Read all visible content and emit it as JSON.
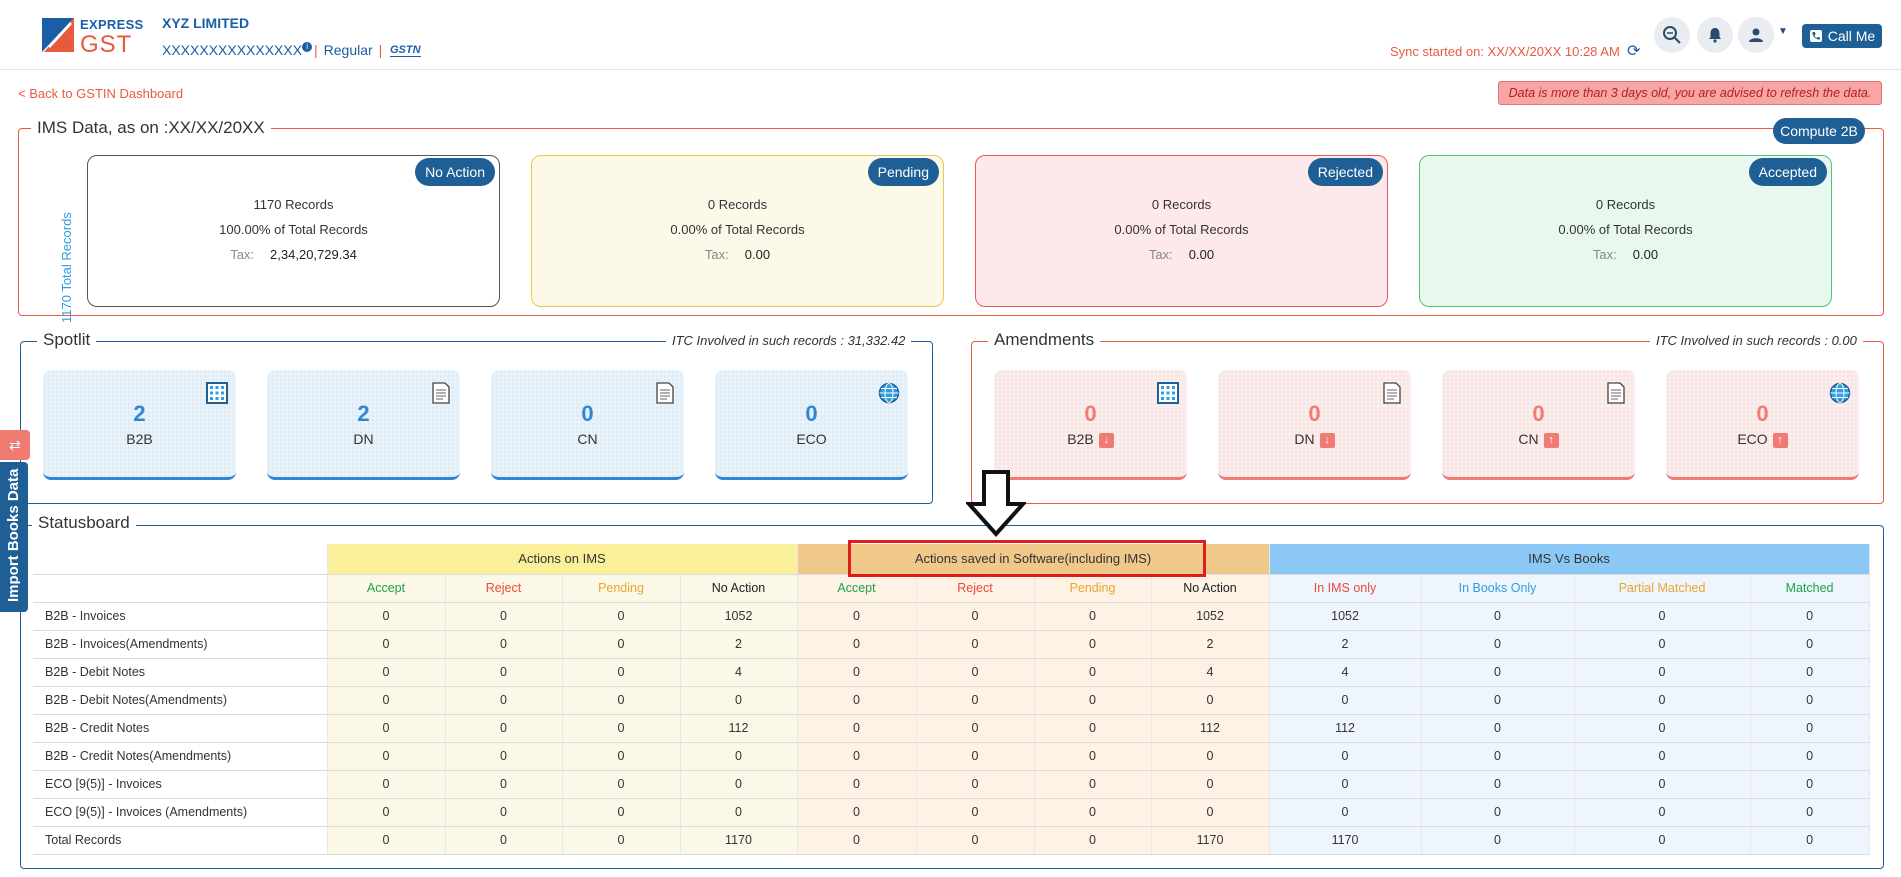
{
  "header": {
    "logo_top": "EXPRESS",
    "logo_bottom": "GST",
    "company": "XYZ LIMITED",
    "gstin": "XXXXXXXXXXXXXXX",
    "reg_type": "Regular",
    "gsn_icon_text": "GSTN",
    "sync_text": "Sync started on: XX/XX/20XX 10:28 AM",
    "call_label": "Call Me"
  },
  "back_link": "< Back to GSTIN Dashboard",
  "stale_alert": "Data is more than 3 days old, you are advised to refresh the data.",
  "ims": {
    "legend": "IMS Data, as on :XX/XX/20XX",
    "compute_label": "Compute 2B",
    "total_label": "1170 Total Records",
    "tax_key": "Tax:",
    "cards": [
      {
        "badge": "No Action",
        "records": "1170 Records",
        "percent": "100.00% of Total Records",
        "tax": "2,34,20,729.34"
      },
      {
        "badge": "Pending",
        "records": "0 Records",
        "percent": "0.00% of Total Records",
        "tax": "0.00"
      },
      {
        "badge": "Rejected",
        "records": "0 Records",
        "percent": "0.00% of Total Records",
        "tax": "0.00"
      },
      {
        "badge": "Accepted",
        "records": "0 Records",
        "percent": "0.00% of Total Records",
        "tax": "0.00"
      }
    ]
  },
  "spotlit": {
    "legend": "Spotlit",
    "note": "ITC Involved in such records : 31,332.42",
    "cards": [
      {
        "value": "2",
        "label": "B2B",
        "icon": "grid-icon"
      },
      {
        "value": "2",
        "label": "DN",
        "icon": "document-icon"
      },
      {
        "value": "0",
        "label": "CN",
        "icon": "document-icon"
      },
      {
        "value": "0",
        "label": "ECO",
        "icon": "globe-icon"
      }
    ]
  },
  "amendments": {
    "legend": "Amendments",
    "note": "ITC Involved in such records : 0.00",
    "cards": [
      {
        "value": "0",
        "label": "B2B",
        "icon": "grid-icon",
        "arrow": "down"
      },
      {
        "value": "0",
        "label": "DN",
        "icon": "document-icon",
        "arrow": "down"
      },
      {
        "value": "0",
        "label": "CN",
        "icon": "document-icon",
        "arrow": "up"
      },
      {
        "value": "0",
        "label": "ECO",
        "icon": "globe-icon",
        "arrow": "up"
      }
    ]
  },
  "import_tab": "Import Books Data",
  "statusboard": {
    "legend": "Statusboard",
    "groups": [
      "Actions on IMS",
      "Actions saved in Software(including IMS)",
      "IMS Vs Books"
    ],
    "columns": [
      "Accept",
      "Reject",
      "Pending",
      "No Action",
      "Accept",
      "Reject",
      "Pending",
      "No Action",
      "In IMS only",
      "In Books Only",
      "Partial Matched",
      "Matched"
    ],
    "rows": [
      {
        "label": "B2B - Invoices",
        "values": [
          "0",
          "0",
          "0",
          "1052",
          "0",
          "0",
          "0",
          "1052",
          "1052",
          "0",
          "0",
          "0"
        ]
      },
      {
        "label": "B2B - Invoices(Amendments)",
        "values": [
          "0",
          "0",
          "0",
          "2",
          "0",
          "0",
          "0",
          "2",
          "2",
          "0",
          "0",
          "0"
        ]
      },
      {
        "label": "B2B - Debit Notes",
        "values": [
          "0",
          "0",
          "0",
          "4",
          "0",
          "0",
          "0",
          "4",
          "4",
          "0",
          "0",
          "0"
        ]
      },
      {
        "label": "B2B - Debit Notes(Amendments)",
        "values": [
          "0",
          "0",
          "0",
          "0",
          "0",
          "0",
          "0",
          "0",
          "0",
          "0",
          "0",
          "0"
        ]
      },
      {
        "label": "B2B - Credit Notes",
        "values": [
          "0",
          "0",
          "0",
          "112",
          "0",
          "0",
          "0",
          "112",
          "112",
          "0",
          "0",
          "0"
        ]
      },
      {
        "label": "B2B - Credit Notes(Amendments)",
        "values": [
          "0",
          "0",
          "0",
          "0",
          "0",
          "0",
          "0",
          "0",
          "0",
          "0",
          "0",
          "0"
        ]
      },
      {
        "label": "ECO [9(5)] - Invoices",
        "values": [
          "0",
          "0",
          "0",
          "0",
          "0",
          "0",
          "0",
          "0",
          "0",
          "0",
          "0",
          "0"
        ]
      },
      {
        "label": "ECO [9(5)] - Invoices (Amendments)",
        "values": [
          "0",
          "0",
          "0",
          "0",
          "0",
          "0",
          "0",
          "0",
          "0",
          "0",
          "0",
          "0"
        ]
      },
      {
        "label": "Total Records",
        "values": [
          "0",
          "0",
          "0",
          "1170",
          "0",
          "0",
          "0",
          "1170",
          "1170",
          "0",
          "0",
          "0"
        ]
      }
    ]
  },
  "colors": {
    "brand": "#1e5f96",
    "accent": "#e85a3e",
    "highlight": "#e01c1c"
  }
}
